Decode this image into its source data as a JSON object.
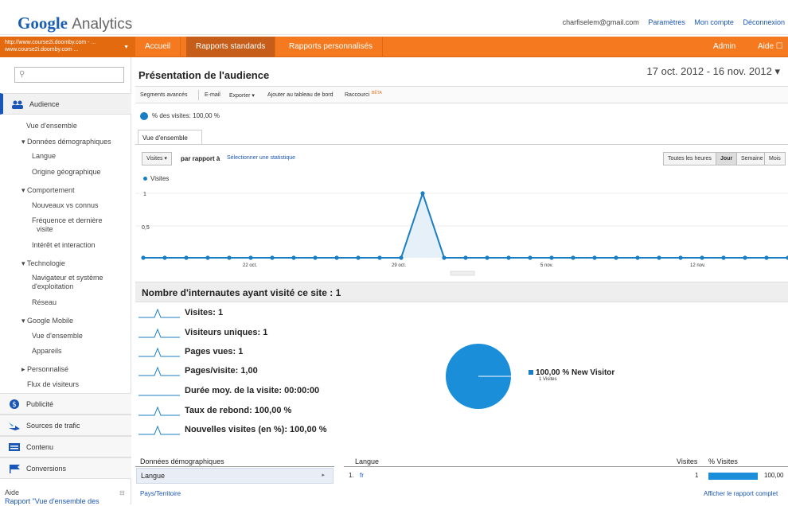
{
  "header": {
    "logo_google": "Google",
    "logo_product": "Analytics",
    "email": "charfiselem@gmail.com",
    "links": [
      "Paramètres",
      "Mon compte",
      "Déconnexion"
    ]
  },
  "nav": {
    "account_line1": "http://www.course2i.doomby.com - ...",
    "account_line2": "www.course2i.doomby.com ...",
    "tabs": [
      "Accueil",
      "Rapports standards",
      "Rapports personnalisés"
    ],
    "admin": "Admin",
    "help": "Aide ☐"
  },
  "sidebar": {
    "search_placeholder": "",
    "audience": "Audience",
    "items": [
      "Vue d'ensemble",
      "▾ Données démographiques",
      "Langue",
      "Origine géographique",
      "▾ Comportement",
      "Nouveaux vs connus",
      "Fréquence et dernière",
      "visite",
      "Intérêt et interaction",
      "▾ Technologie",
      "Navigateur et système",
      "d'exploitation",
      "Réseau",
      "▾ Google Mobile",
      "Vue d'ensemble",
      "Appareils",
      "▸ Personnalisé",
      "Flux de visiteurs"
    ],
    "sections": [
      "Publicité",
      "Sources de trafic",
      "Contenu",
      "Conversions"
    ],
    "help_title": "Aide",
    "help_link": "Rapport \"Vue d'ensemble des"
  },
  "report": {
    "title": "Présentation de l'audience",
    "date_range": "17 oct. 2012 - 16 nov. 2012 ▾",
    "toolbar": [
      "Segments avancés",
      "E-mail",
      "Exporter ▾",
      "Ajouter au tableau de bord",
      "Raccourci",
      "BÊTA"
    ],
    "segment": "% des visites: 100,00 %",
    "overview_tab": "Vue d'ensemble",
    "metric_dropdown": "Visites ▾",
    "compare_label": "par rapport à",
    "select_metric": "Sélectionner une statistique",
    "time_buttons": [
      "Toutes les heures",
      "Jour",
      "Semaine",
      "Mois"
    ],
    "legend": "Visites"
  },
  "chart_data": {
    "type": "area",
    "series": [
      {
        "name": "Visites",
        "values": [
          0,
          0,
          0,
          0,
          0,
          0,
          0,
          0,
          0,
          0,
          0,
          0,
          0,
          0,
          0,
          0,
          0,
          0,
          0,
          0,
          0,
          0,
          0,
          0,
          0,
          0,
          0,
          0,
          0,
          0,
          0,
          0,
          0,
          0,
          0,
          0,
          0,
          0,
          0,
          0,
          0,
          0,
          0,
          0,
          0,
          0,
          0,
          0,
          0,
          0,
          0,
          0,
          0,
          0,
          0,
          0,
          0,
          0,
          0,
          0,
          0,
          0
        ]
      }
    ],
    "peak_index": 13,
    "peak_value": 1,
    "y_ticks": [
      "1",
      "0,5"
    ],
    "x_tick_labels": [
      "22 oct.",
      "29 oct.",
      "5 nov.",
      "12 nov."
    ],
    "ylim": [
      0,
      1
    ],
    "color": "#1a7ec5"
  },
  "summary": {
    "title": "Nombre d'internautes ayant visité ce site : 1",
    "metrics": [
      "Visites: 1",
      "Visiteurs uniques: 1",
      "Pages vues: 1",
      "Pages/visite: 1,00",
      "Durée moy. de la visite: 00:00:00",
      "Taux de rebond: 100,00 %",
      "Nouvelles visites (en %): 100,00 %"
    ],
    "pie_label": "100,00 % New Visitor",
    "pie_sub": "1 Visites",
    "pie_color": "#1a8ed8"
  },
  "table": {
    "col_demo": "Données démographiques",
    "col_lang": "Langue",
    "col_visits": "Visites",
    "col_pct": "% Visites",
    "row_label": "Langue",
    "row_rank": "1.",
    "row_value": "fr",
    "row_visits": "1",
    "row_pct": "100,00",
    "link_country": "Pays/Territoire",
    "link_full": "Afficher le rapport complet"
  }
}
